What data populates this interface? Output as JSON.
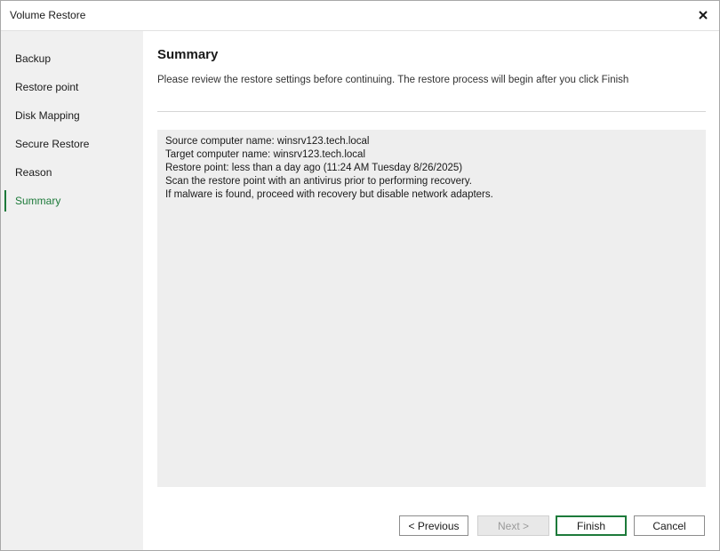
{
  "window": {
    "title": "Volume Restore",
    "close_icon": "close-icon"
  },
  "sidebar": {
    "items": [
      {
        "label": "Backup",
        "active": false
      },
      {
        "label": "Restore point",
        "active": false
      },
      {
        "label": "Disk Mapping",
        "active": false
      },
      {
        "label": "Secure Restore",
        "active": false
      },
      {
        "label": "Reason",
        "active": false
      },
      {
        "label": "Summary",
        "active": true
      }
    ]
  },
  "main": {
    "title": "Summary",
    "subtitle": "Please review the restore settings before continuing. The restore process will begin after you click Finish",
    "summary_lines": [
      "Source computer name: winsrv123.tech.local",
      "Target computer name: winsrv123.tech.local",
      "Restore point: less than a day ago (11:24 AM Tuesday 8/26/2025)",
      "Scan the restore point with an antivirus prior to performing recovery.",
      "If malware is found, proceed with recovery but disable network adapters."
    ]
  },
  "buttons": {
    "previous": "< Previous",
    "next": "Next >",
    "finish": "Finish",
    "cancel": "Cancel"
  },
  "colors": {
    "accent": "#1d7a3a",
    "sidebar_bg": "#f0f0f0",
    "summary_bg": "#eeeeee"
  }
}
